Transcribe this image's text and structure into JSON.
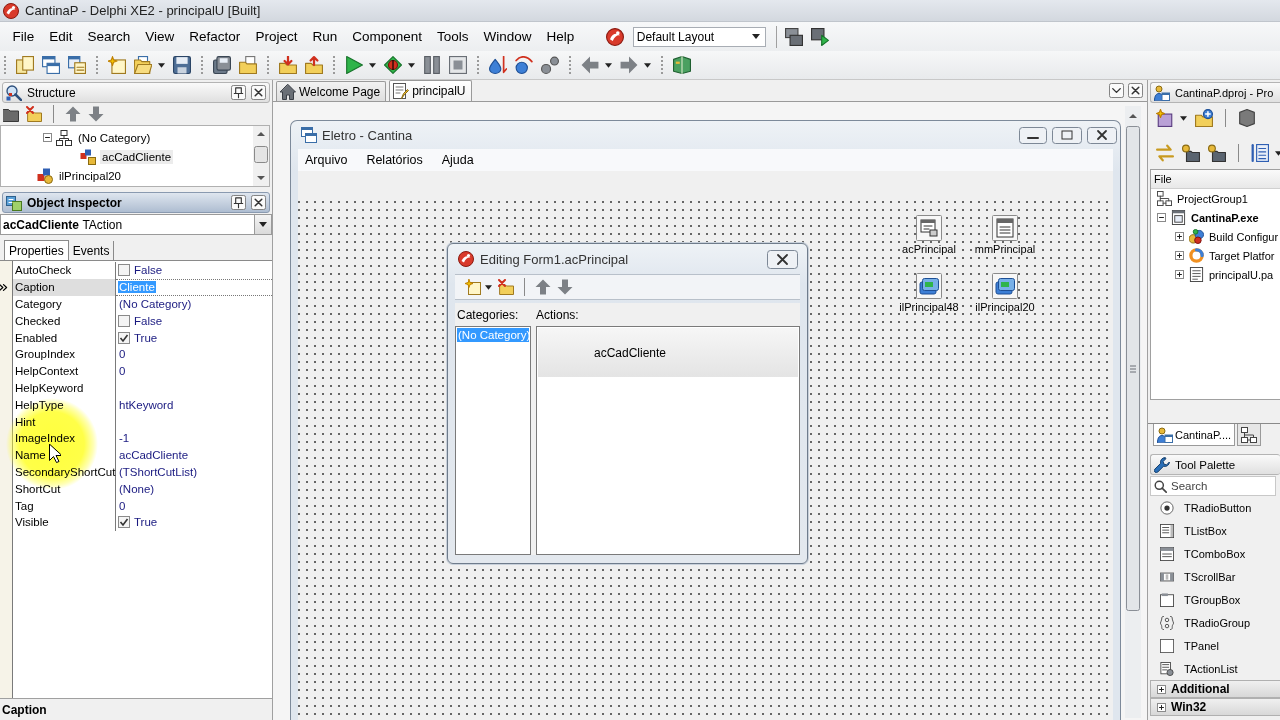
{
  "window": {
    "title": "CantinaP - Delphi XE2 - principalU [Built]"
  },
  "menu": [
    "File",
    "Edit",
    "Search",
    "View",
    "Refactor",
    "Project",
    "Run",
    "Component",
    "Tools",
    "Window",
    "Help"
  ],
  "layout_dropdown": {
    "value": "Default Layout"
  },
  "structure": {
    "title": "Structure",
    "tree": [
      {
        "label": "(No Category)",
        "expanded": true,
        "selected": false,
        "children": [
          {
            "label": "acCadCliente",
            "selected": true
          }
        ]
      },
      {
        "label": "ilPrincipal20",
        "selected": false
      }
    ]
  },
  "object_inspector": {
    "title": "Object Inspector",
    "object_name": "acCadCliente",
    "object_type": "TAction",
    "tabs": [
      {
        "label": "Properties",
        "selected": true
      },
      {
        "label": "Events",
        "selected": false
      }
    ],
    "properties": [
      {
        "name": "AutoCheck",
        "kind": "bool",
        "value": "False",
        "checked": false,
        "selected": false
      },
      {
        "name": "Caption",
        "kind": "text",
        "value": "Cliente",
        "selected": true
      },
      {
        "name": "Category",
        "kind": "text",
        "value": "(No Category)",
        "selected": false
      },
      {
        "name": "Checked",
        "kind": "bool",
        "value": "False",
        "checked": false,
        "selected": false
      },
      {
        "name": "Enabled",
        "kind": "bool",
        "value": "True",
        "checked": true,
        "selected": false
      },
      {
        "name": "GroupIndex",
        "kind": "text",
        "value": "0",
        "selected": false
      },
      {
        "name": "HelpContext",
        "kind": "text",
        "value": "0",
        "selected": false
      },
      {
        "name": "HelpKeyword",
        "kind": "text",
        "selected": false
      },
      {
        "name": "HelpType",
        "kind": "text",
        "value": "htKeyword",
        "selected": false
      },
      {
        "name": "Hint",
        "kind": "text",
        "selected": false
      },
      {
        "name": "ImageIndex",
        "kind": "text",
        "value": "-1",
        "selected": false
      },
      {
        "name": "Name",
        "kind": "text",
        "value": "acCadCliente",
        "selected": false
      },
      {
        "name": "SecondaryShortCut",
        "kind": "text",
        "value": "(TShortCutList)",
        "selected": false
      },
      {
        "name": "ShortCut",
        "kind": "text",
        "value": "(None)",
        "selected": false
      },
      {
        "name": "Tag",
        "kind": "text",
        "value": "0",
        "selected": false
      },
      {
        "name": "Visible",
        "kind": "bool",
        "value": "True",
        "checked": true,
        "selected": false
      }
    ]
  },
  "status_bar": {
    "text": "Caption"
  },
  "editor_tabs": [
    {
      "label": "Welcome Page",
      "kind": "welcome",
      "selected": false
    },
    {
      "label": "principalU",
      "kind": "unit",
      "selected": true
    }
  ],
  "form": {
    "title": "Eletro - Cantina",
    "menu": [
      "Arquivo",
      "Relatórios",
      "Ajuda"
    ],
    "components": [
      {
        "name": "acPrincipal",
        "kind": "action_list"
      },
      {
        "name": "mmPrincipal",
        "kind": "main_menu"
      },
      {
        "name": "ilPrincipal48",
        "kind": "image_list"
      },
      {
        "name": "ilPrincipal20",
        "kind": "image_list"
      }
    ]
  },
  "action_editor": {
    "title": "Editing Form1.acPrincipal",
    "categories_label": "Categories:",
    "actions_label": "Actions:",
    "categories": [
      {
        "label": "(No Category)",
        "selected": true
      }
    ],
    "actions": [
      {
        "label": "acCadCliente",
        "selected": true
      }
    ]
  },
  "project_manager": {
    "title": "CantinaP.dproj - Pro",
    "column": "File",
    "tree": [
      {
        "label": "ProjectGroup1",
        "kind": "group",
        "active": false,
        "children": [
          {
            "label": "CantinaP.exe",
            "kind": "project",
            "active": true,
            "expanded": true,
            "children": [
              {
                "label": "Build Configur",
                "kind": "build",
                "active": false,
                "expanded": false
              },
              {
                "label": "Target Platfor",
                "kind": "platform",
                "active": false,
                "expanded": false
              },
              {
                "label": "principalU.pa",
                "kind": "unit",
                "active": false,
                "expanded": false
              }
            ]
          }
        ]
      }
    ]
  },
  "side_tabs": [
    {
      "label": "CantinaP....",
      "selected": true
    },
    {
      "selected": false
    }
  ],
  "tool_palette": {
    "title": "Tool Palette",
    "search": {
      "placeholder": "Search"
    },
    "items": [
      {
        "label": "TRadioButton",
        "kind": "radio"
      },
      {
        "label": "TListBox",
        "kind": "listbox"
      },
      {
        "label": "TComboBox",
        "kind": "combobox"
      },
      {
        "label": "TScrollBar",
        "kind": "scrollbar"
      },
      {
        "label": "TGroupBox",
        "kind": "groupbox"
      },
      {
        "label": "TRadioGroup",
        "kind": "radiogroup"
      },
      {
        "label": "TPanel",
        "kind": "panel"
      },
      {
        "label": "TActionList",
        "kind": "actionlist"
      }
    ],
    "categories": [
      {
        "label": "Additional",
        "expanded": false
      },
      {
        "label": "Win32",
        "expanded": false
      }
    ]
  }
}
